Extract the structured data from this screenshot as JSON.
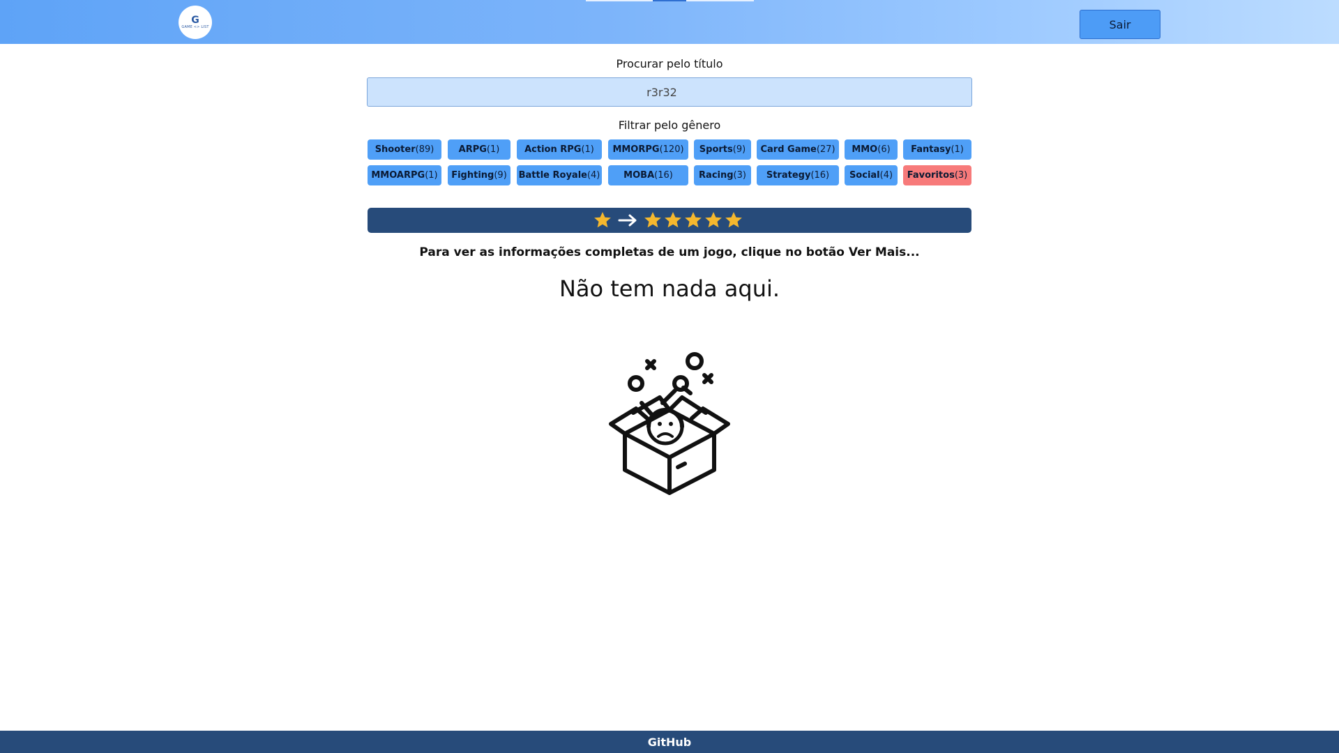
{
  "header": {
    "logo_letter": "G",
    "logo_subtext": "GAME <> LIST",
    "logout_label": "Sair"
  },
  "search": {
    "label": "Procurar pelo título",
    "value": "r3r32"
  },
  "genres": {
    "label": "Filtrar pelo gênero",
    "items": [
      {
        "name": "Shooter",
        "count": "(89)"
      },
      {
        "name": "ARPG",
        "count": "(1)"
      },
      {
        "name": "Action RPG",
        "count": "(1)"
      },
      {
        "name": "MMORPG",
        "count": "(120)"
      },
      {
        "name": "Sports",
        "count": "(9)"
      },
      {
        "name": "Card Game",
        "count": "(27)"
      },
      {
        "name": "MMO",
        "count": "(6)"
      },
      {
        "name": "Fantasy",
        "count": "(1)"
      },
      {
        "name": "MMOARPG",
        "count": "(1)"
      },
      {
        "name": "Fighting",
        "count": "(9)"
      },
      {
        "name": "Battle Royale",
        "count": "(4)"
      },
      {
        "name": "MOBA",
        "count": "(16)"
      },
      {
        "name": "Racing",
        "count": "(3)"
      },
      {
        "name": "Strategy",
        "count": "(16)"
      },
      {
        "name": "Social",
        "count": "(4)"
      },
      {
        "name": "Favoritos",
        "count": "(3)"
      }
    ]
  },
  "rating_sort": {
    "from_stars": 1,
    "to_stars": 5,
    "icons": [
      "star-icon",
      "arrow-right-icon"
    ],
    "star_color": "#f5b82e",
    "bar_color": "#274b7a"
  },
  "content": {
    "info_text": "Para ver as informações completas de um jogo, clique no botão Ver Mais...",
    "empty_title": "Não tem nada aqui.",
    "empty_icon": "empty-box-icon"
  },
  "footer": {
    "link_label": "GitHub"
  },
  "colors": {
    "genre_button": "#4f9ff7",
    "favorites_button": "#f77a7a",
    "search_background": "#cce3fd"
  }
}
